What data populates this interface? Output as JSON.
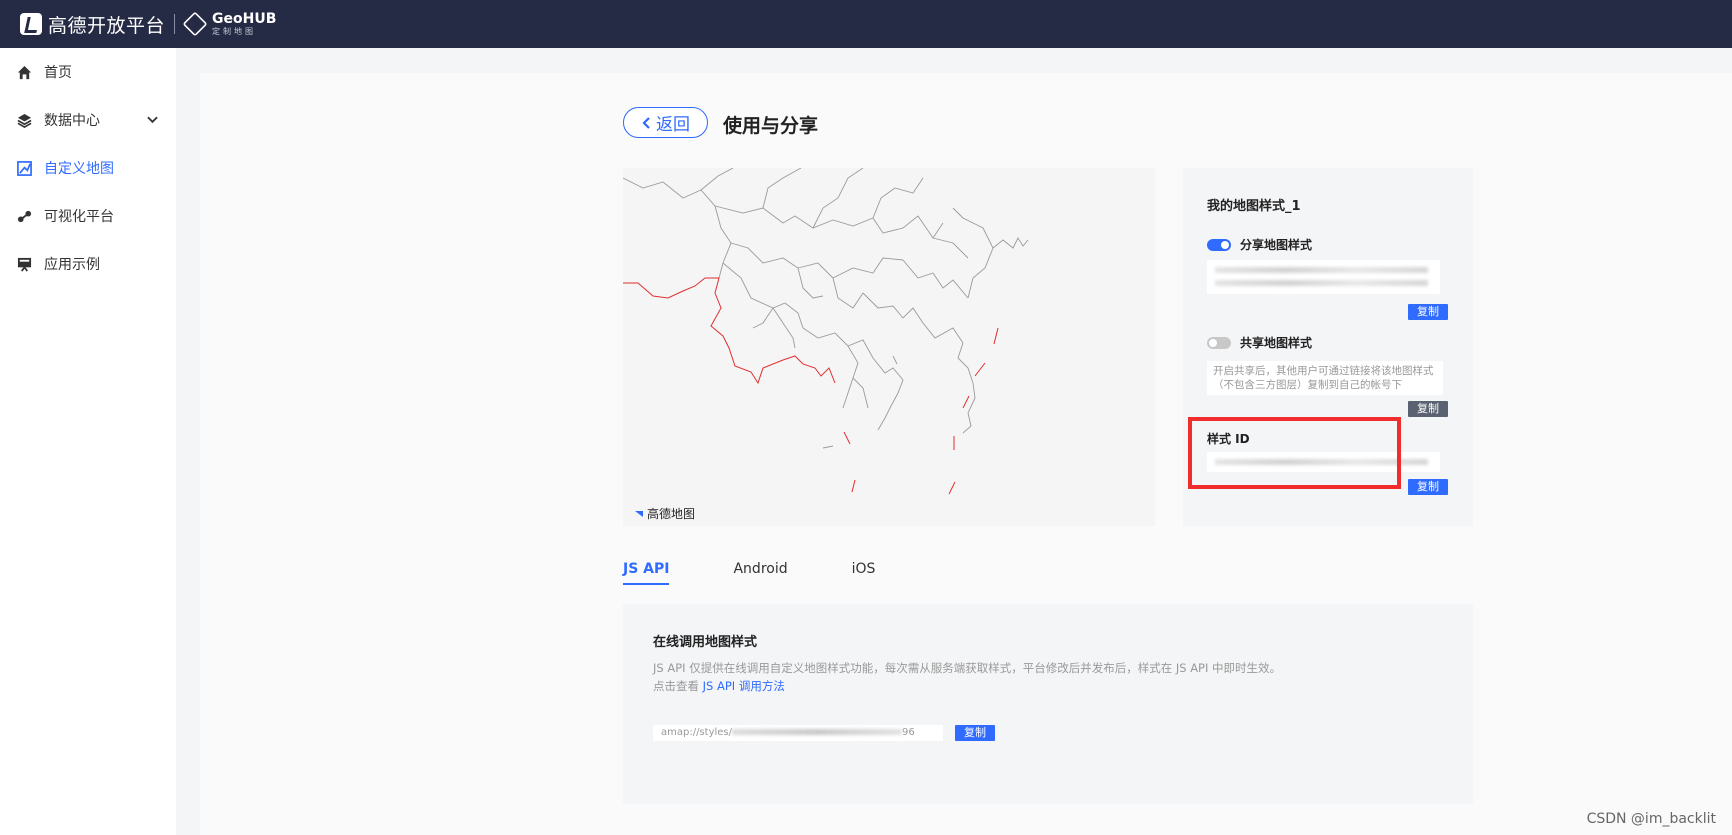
{
  "header": {
    "brand": "高德开放平台",
    "geohub_title": "GeoHUB",
    "geohub_sub": "定制地图"
  },
  "sidebar": {
    "items": [
      {
        "label": "首页",
        "icon": "home-icon"
      },
      {
        "label": "数据中心",
        "icon": "layers-icon",
        "expand": "chevron-down-icon"
      },
      {
        "label": "自定义地图",
        "icon": "map-edit-icon",
        "active": true
      },
      {
        "label": "可视化平台",
        "icon": "chart-icon"
      },
      {
        "label": "应用示例",
        "icon": "monitor-icon"
      }
    ]
  },
  "page": {
    "back_label": "返回",
    "title": "使用与分享"
  },
  "map": {
    "logo_text": "高德地图"
  },
  "panel": {
    "style_name": "我的地图样式_1",
    "share_label": "分享地图样式",
    "share_enabled": true,
    "copy_label": "复制",
    "public_label": "共享地图样式",
    "public_enabled": false,
    "public_desc": "开启共享后，其他用户可通过链接将该地图样式（不包含三方图层）复制到自己的帐号下",
    "style_id_label": "样式 ID"
  },
  "tabs": [
    "JS API",
    "Android",
    "iOS"
  ],
  "api": {
    "title": "在线调用地图样式",
    "desc": "JS API 仅提供在线调用自定义地图样式功能，每次需从服务端获取样式，平台修改后并发布后，样式在 JS API 中即时生效。",
    "desc2_prefix": "点击查看 ",
    "desc2_link": "JS API 调用方法",
    "url_prefix": "amap://styles/",
    "url_suffix": "96",
    "copy_label": "复制"
  },
  "watermark": "CSDN @im_backlit",
  "colors": {
    "topbar": "#262b45",
    "accent": "#2f6bff",
    "highlight": "#f02c2c"
  }
}
